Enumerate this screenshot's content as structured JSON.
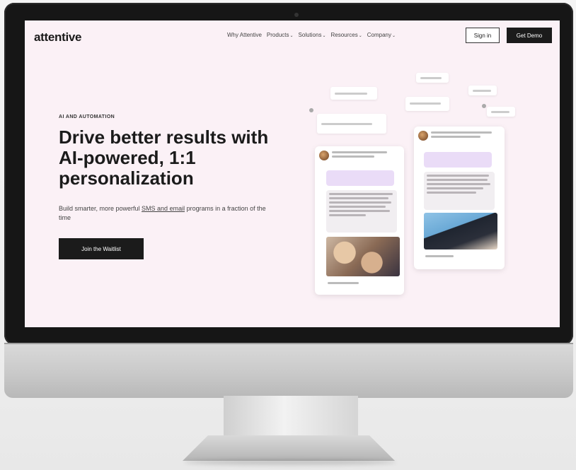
{
  "nav": {
    "logo": "attentive",
    "links": [
      {
        "label": "Why Attentive",
        "chevron": ""
      },
      {
        "label": "Products",
        "chevron": "⌄"
      },
      {
        "label": "Solutions",
        "chevron": "⌄"
      },
      {
        "label": "Resources",
        "chevron": "⌄"
      },
      {
        "label": "Company",
        "chevron": "⌄"
      }
    ],
    "signin": "Sign in",
    "demo": "Get Demo"
  },
  "hero": {
    "eyebrow": "AI AND AUTOMATION",
    "headline": "Drive better results with AI-powered, 1:1 personalization",
    "subhead_pre": "Build smarter, more powerful ",
    "subhead_ul": "SMS and email",
    "subhead_post": " programs in a fraction of the time",
    "cta": "Join the Waitlist"
  },
  "colors": {
    "screen_bg": "#fbf1f6",
    "primary_dark": "#1b1b1b",
    "bubble_lavender": "#eadcf7"
  },
  "icons": [
    "avatar-icon",
    "sparkle-icon"
  ]
}
